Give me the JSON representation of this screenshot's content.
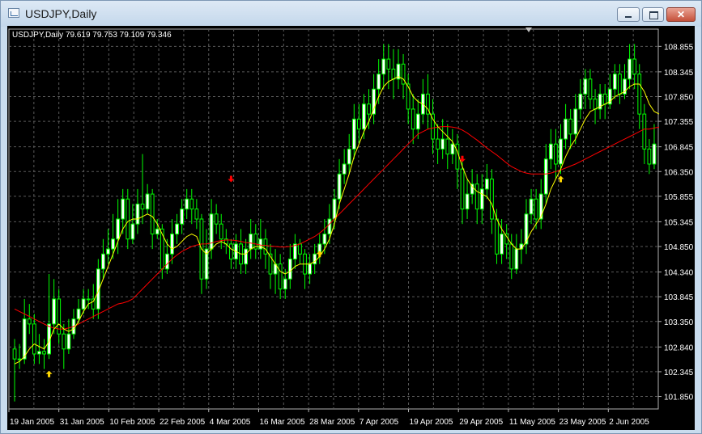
{
  "window": {
    "title": "USDJPY,Daily"
  },
  "colors": {
    "background": "#000000",
    "grid": "#5a5a5a",
    "axis_text": "#ffffff",
    "bull_candle": "#ffffff",
    "bear_candle": "#000000",
    "wick": "#00ff00",
    "ma_fast": "#ffff00",
    "ma_slow": "#ff0000",
    "arrow_up": "#ffd700",
    "arrow_down": "#ff0000"
  },
  "chart_data": {
    "type": "candlestick",
    "header": "USDJPY,Daily  79.619 79.753 79.109 79.346",
    "y_ticks": [
      "108.855",
      "108.345",
      "107.850",
      "107.355",
      "106.845",
      "106.350",
      "105.855",
      "105.345",
      "104.850",
      "104.340",
      "103.845",
      "103.350",
      "102.840",
      "102.345",
      "101.850"
    ],
    "x_ticks": [
      "19 Jan 2005",
      "31 Jan 2005",
      "10 Feb 2005",
      "22 Feb 2005",
      "4 Mar 2005",
      "16 Mar 2005",
      "28 Mar 2005",
      "7 Apr 2005",
      "19 Apr 2005",
      "29 Apr 2005",
      "11 May 2005",
      "23 May 2005",
      "2 Jun 2005"
    ],
    "ylim": [
      101.6,
      109.2
    ],
    "grid": true,
    "candles": [
      [
        102.8,
        102.6,
        103.0,
        101.75
      ],
      [
        102.6,
        102.6,
        102.9,
        102.4
      ],
      [
        102.6,
        103.4,
        103.8,
        102.5
      ],
      [
        103.4,
        103.3,
        103.7,
        103.1
      ],
      [
        103.3,
        102.7,
        103.5,
        102.5
      ],
      [
        102.7,
        102.75,
        103.1,
        102.5
      ],
      [
        102.75,
        102.7,
        103.0,
        102.4
      ],
      [
        102.7,
        103.3,
        104.3,
        102.6
      ],
      [
        103.3,
        103.8,
        104.2,
        103.1
      ],
      [
        103.8,
        103.1,
        104.0,
        102.9
      ],
      [
        103.1,
        102.8,
        103.3,
        102.4
      ],
      [
        102.8,
        103.1,
        103.4,
        102.7
      ],
      [
        103.1,
        103.4,
        103.6,
        103.0
      ],
      [
        103.4,
        103.6,
        103.8,
        103.3
      ],
      [
        103.6,
        103.8,
        104.0,
        103.5
      ],
      [
        103.8,
        103.8,
        104.0,
        103.6
      ],
      [
        103.8,
        103.6,
        104.1,
        103.4
      ],
      [
        103.6,
        104.4,
        104.6,
        103.4
      ],
      [
        104.4,
        104.7,
        105.0,
        104.2
      ],
      [
        104.7,
        104.8,
        105.2,
        104.5
      ],
      [
        104.8,
        105.0,
        105.5,
        104.6
      ],
      [
        105.0,
        105.4,
        105.8,
        104.7
      ],
      [
        105.4,
        105.8,
        106.0,
        105.1
      ],
      [
        105.8,
        105.0,
        106.0,
        104.8
      ],
      [
        105.0,
        105.3,
        105.7,
        104.9
      ],
      [
        105.3,
        105.7,
        106.0,
        105.1
      ],
      [
        105.7,
        105.6,
        106.7,
        105.3
      ],
      [
        105.6,
        105.9,
        106.1,
        105.5
      ],
      [
        105.9,
        105.1,
        106.0,
        104.8
      ],
      [
        105.1,
        105.2,
        105.4,
        105.0
      ],
      [
        105.2,
        104.4,
        105.3,
        104.2
      ],
      [
        104.4,
        104.7,
        105.0,
        104.3
      ],
      [
        104.7,
        105.1,
        105.4,
        104.5
      ],
      [
        105.1,
        105.3,
        105.5,
        104.9
      ],
      [
        105.3,
        105.6,
        105.8,
        105.1
      ],
      [
        105.6,
        105.8,
        106.0,
        105.4
      ],
      [
        105.8,
        105.6,
        106.0,
        105.3
      ],
      [
        105.6,
        105.4,
        105.8,
        105.2
      ],
      [
        105.4,
        104.2,
        105.5,
        103.9
      ],
      [
        104.2,
        104.8,
        105.2,
        104.0
      ],
      [
        104.8,
        105.5,
        105.8,
        104.6
      ],
      [
        105.5,
        105.3,
        105.7,
        105.1
      ],
      [
        105.3,
        105.0,
        105.5,
        104.8
      ],
      [
        105.0,
        104.9,
        105.2,
        104.7
      ],
      [
        104.9,
        104.6,
        105.0,
        104.4
      ],
      [
        104.6,
        104.9,
        105.1,
        104.4
      ],
      [
        104.9,
        104.5,
        105.2,
        104.3
      ],
      [
        104.5,
        104.8,
        105.0,
        104.3
      ],
      [
        104.8,
        105.1,
        105.4,
        104.6
      ],
      [
        105.1,
        104.8,
        105.3,
        104.6
      ],
      [
        104.8,
        105.0,
        105.4,
        104.6
      ],
      [
        105.0,
        104.7,
        105.2,
        104.4
      ],
      [
        104.7,
        104.3,
        104.9,
        104.0
      ],
      [
        104.3,
        104.5,
        104.8,
        103.9
      ],
      [
        104.5,
        104.0,
        104.7,
        103.8
      ],
      [
        104.0,
        104.2,
        104.4,
        103.8
      ],
      [
        104.2,
        104.6,
        104.9,
        104.0
      ],
      [
        104.6,
        104.9,
        105.1,
        104.4
      ],
      [
        104.9,
        104.7,
        105.0,
        104.5
      ],
      [
        104.7,
        104.3,
        104.8,
        104.0
      ],
      [
        104.3,
        104.5,
        104.7,
        104.1
      ],
      [
        104.5,
        104.7,
        104.9,
        104.3
      ],
      [
        104.7,
        104.9,
        105.1,
        104.5
      ],
      [
        104.9,
        105.1,
        105.4,
        104.7
      ],
      [
        105.1,
        105.4,
        105.7,
        104.9
      ],
      [
        105.4,
        105.8,
        106.0,
        105.2
      ],
      [
        105.8,
        106.3,
        106.6,
        105.6
      ],
      [
        106.3,
        106.5,
        106.8,
        106.1
      ],
      [
        106.5,
        106.8,
        107.1,
        106.3
      ],
      [
        106.8,
        107.4,
        107.7,
        106.6
      ],
      [
        107.4,
        107.2,
        107.7,
        106.9
      ],
      [
        107.2,
        107.7,
        107.9,
        107.0
      ],
      [
        107.7,
        107.5,
        108.0,
        107.2
      ],
      [
        107.5,
        108.0,
        108.3,
        107.3
      ],
      [
        108.0,
        108.3,
        108.6,
        107.7
      ],
      [
        108.3,
        108.6,
        108.9,
        108.0
      ],
      [
        108.6,
        108.4,
        108.9,
        108.0
      ],
      [
        108.4,
        108.2,
        108.8,
        107.8
      ],
      [
        108.2,
        108.5,
        108.8,
        108.0
      ],
      [
        108.5,
        108.1,
        108.7,
        107.8
      ],
      [
        108.1,
        107.6,
        108.3,
        107.3
      ],
      [
        107.6,
        107.2,
        107.9,
        106.9
      ],
      [
        107.2,
        107.5,
        107.8,
        107.0
      ],
      [
        107.5,
        107.9,
        108.2,
        107.3
      ],
      [
        107.9,
        107.5,
        108.3,
        107.2
      ],
      [
        107.5,
        107.0,
        107.8,
        106.7
      ],
      [
        107.0,
        106.8,
        107.3,
        106.5
      ],
      [
        106.8,
        107.0,
        107.4,
        106.6
      ],
      [
        107.0,
        106.7,
        107.3,
        106.4
      ],
      [
        106.7,
        106.9,
        107.2,
        106.5
      ],
      [
        106.9,
        106.4,
        107.1,
        106.0
      ],
      [
        106.4,
        105.6,
        106.6,
        105.3
      ],
      [
        105.6,
        105.9,
        106.2,
        105.4
      ],
      [
        105.9,
        106.1,
        106.4,
        105.7
      ],
      [
        106.1,
        105.6,
        106.3,
        105.3
      ],
      [
        105.6,
        106.0,
        106.3,
        105.3
      ],
      [
        106.0,
        106.2,
        106.5,
        105.8
      ],
      [
        106.2,
        105.4,
        106.4,
        105.1
      ],
      [
        105.4,
        104.7,
        105.6,
        104.5
      ],
      [
        104.7,
        105.1,
        105.4,
        104.5
      ],
      [
        105.1,
        104.9,
        105.3,
        104.6
      ],
      [
        104.9,
        104.4,
        105.1,
        104.2
      ],
      [
        104.4,
        104.8,
        105.1,
        104.3
      ],
      [
        104.8,
        104.9,
        105.2,
        104.5
      ],
      [
        104.9,
        105.5,
        105.8,
        104.7
      ],
      [
        105.5,
        105.8,
        106.0,
        105.3
      ],
      [
        105.8,
        105.4,
        106.0,
        105.2
      ],
      [
        105.4,
        105.9,
        106.2,
        105.2
      ],
      [
        105.9,
        106.6,
        106.9,
        105.7
      ],
      [
        106.6,
        106.9,
        107.2,
        106.4
      ],
      [
        106.9,
        106.5,
        107.2,
        106.2
      ],
      [
        106.5,
        107.0,
        107.3,
        106.3
      ],
      [
        107.0,
        107.4,
        107.7,
        106.8
      ],
      [
        107.4,
        107.1,
        107.6,
        106.8
      ],
      [
        107.1,
        107.6,
        107.9,
        106.9
      ],
      [
        107.6,
        107.9,
        108.2,
        107.4
      ],
      [
        107.9,
        108.2,
        108.4,
        107.6
      ],
      [
        108.2,
        107.8,
        108.4,
        107.6
      ],
      [
        107.8,
        107.6,
        108.0,
        107.3
      ],
      [
        107.6,
        107.9,
        108.1,
        107.4
      ],
      [
        107.9,
        107.7,
        108.1,
        107.4
      ],
      [
        107.7,
        108.0,
        108.3,
        107.6
      ],
      [
        108.0,
        108.3,
        108.5,
        107.8
      ],
      [
        108.3,
        107.9,
        108.5,
        107.7
      ],
      [
        107.9,
        108.2,
        108.5,
        107.8
      ],
      [
        108.2,
        108.6,
        108.9,
        108.0
      ],
      [
        108.6,
        108.3,
        108.9,
        108.0
      ],
      [
        108.3,
        107.5,
        108.5,
        107.2
      ],
      [
        107.5,
        106.8,
        107.7,
        106.5
      ],
      [
        106.8,
        106.5,
        107.0,
        106.3
      ],
      [
        106.5,
        106.9,
        107.3,
        106.4
      ]
    ],
    "ma_fast": [
      102.5,
      102.55,
      102.65,
      102.8,
      102.9,
      102.85,
      102.8,
      102.95,
      103.2,
      103.3,
      103.2,
      103.15,
      103.2,
      103.35,
      103.55,
      103.7,
      103.75,
      103.95,
      104.2,
      104.45,
      104.7,
      104.95,
      105.2,
      105.35,
      105.4,
      105.4,
      105.45,
      105.5,
      105.45,
      105.3,
      105.1,
      104.9,
      104.8,
      104.85,
      104.95,
      105.05,
      105.1,
      105.05,
      104.8,
      104.7,
      104.8,
      104.9,
      104.95,
      104.9,
      104.8,
      104.75,
      104.7,
      104.7,
      104.8,
      104.85,
      104.85,
      104.8,
      104.65,
      104.5,
      104.35,
      104.3,
      104.35,
      104.45,
      104.5,
      104.5,
      104.5,
      104.55,
      104.65,
      104.8,
      105.0,
      105.3,
      105.7,
      106.0,
      106.3,
      106.65,
      106.9,
      107.15,
      107.35,
      107.6,
      107.85,
      108.05,
      108.15,
      108.2,
      108.25,
      108.2,
      108.05,
      107.85,
      107.75,
      107.7,
      107.6,
      107.4,
      107.25,
      107.15,
      107.05,
      106.95,
      106.75,
      106.45,
      106.2,
      106.05,
      105.95,
      105.9,
      105.85,
      105.7,
      105.4,
      105.2,
      105.05,
      104.9,
      104.8,
      104.8,
      104.95,
      105.15,
      105.3,
      105.45,
      105.7,
      106.0,
      106.2,
      106.4,
      106.65,
      106.85,
      107.0,
      107.2,
      107.4,
      107.55,
      107.6,
      107.65,
      107.7,
      107.75,
      107.85,
      107.9,
      107.95,
      108.05,
      108.1,
      108.1,
      107.95,
      107.7,
      107.55,
      107.5
    ],
    "ma_slow": [
      103.6,
      103.55,
      103.5,
      103.45,
      103.4,
      103.35,
      103.3,
      103.25,
      103.22,
      103.2,
      103.2,
      103.22,
      103.25,
      103.3,
      103.35,
      103.4,
      103.45,
      103.5,
      103.55,
      103.6,
      103.65,
      103.7,
      103.72,
      103.75,
      103.8,
      103.9,
      104.0,
      104.1,
      104.2,
      104.3,
      104.4,
      104.5,
      104.6,
      104.68,
      104.75,
      104.8,
      104.85,
      104.88,
      104.9,
      104.9,
      104.92,
      104.95,
      104.97,
      104.98,
      104.98,
      104.97,
      104.95,
      104.93,
      104.92,
      104.9,
      104.88,
      104.87,
      104.86,
      104.85,
      104.84,
      104.84,
      104.85,
      104.87,
      104.9,
      104.95,
      105.0,
      105.05,
      105.12,
      105.2,
      105.3,
      105.4,
      105.5,
      105.6,
      105.7,
      105.8,
      105.9,
      106.0,
      106.1,
      106.2,
      106.3,
      106.4,
      106.5,
      106.6,
      106.7,
      106.8,
      106.9,
      107.0,
      107.1,
      107.15,
      107.2,
      107.22,
      107.24,
      107.25,
      107.25,
      107.24,
      107.22,
      107.18,
      107.12,
      107.05,
      106.98,
      106.9,
      106.82,
      106.75,
      106.68,
      106.6,
      106.52,
      106.45,
      106.4,
      106.35,
      106.32,
      106.3,
      106.3,
      106.3,
      106.3,
      106.32,
      106.35,
      106.38,
      106.42,
      106.46,
      106.5,
      106.55,
      106.6,
      106.65,
      106.7,
      106.75,
      106.8,
      106.85,
      106.9,
      106.95,
      107.0,
      107.05,
      107.1,
      107.15,
      107.2,
      107.2,
      107.22,
      107.24
    ],
    "arrows": [
      {
        "index": 7,
        "price": 102.3,
        "dir": "up"
      },
      {
        "index": 62,
        "price": 104.7,
        "dir": "up"
      },
      {
        "index": 44,
        "price": 106.2,
        "dir": "down"
      },
      {
        "index": 91,
        "price": 106.6,
        "dir": "down"
      },
      {
        "index": 111,
        "price": 106.2,
        "dir": "up"
      }
    ]
  }
}
